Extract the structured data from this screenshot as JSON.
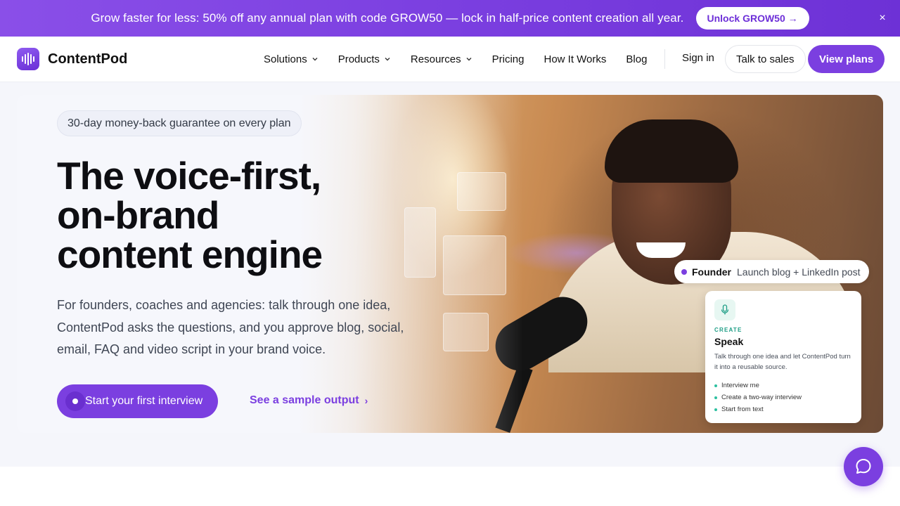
{
  "promo": {
    "text": "Grow faster for less: 50% off any annual plan with code GROW50 — lock in half-price content creation all year.",
    "button": "Unlock GROW50 →",
    "close": "×"
  },
  "nav": {
    "brand": "ContentPod",
    "links": [
      "Solutions",
      "Products",
      "Resources",
      "Pricing",
      "How It Works",
      "Blog"
    ],
    "sign_in": "Sign in",
    "talk_to_sales": "Talk to sales",
    "view_plans": "View plans"
  },
  "hero": {
    "badge": "30-day money-back guarantee on every plan",
    "headline": [
      "The voice-first,",
      "on-brand",
      "content engine"
    ],
    "subcopy": "For founders, coaches and agencies: talk through one idea, ContentPod asks the questions, and you approve blog, social, email, FAQ and video script in your brand voice.",
    "cta_primary": "Start your first interview",
    "cta_secondary": "See a sample output",
    "cta_secondary_arrow": "›"
  },
  "role_pill": {
    "role": "Founder",
    "task": "Launch blog + LinkedIn post"
  },
  "speak_card": {
    "label": "CREATE",
    "title": "Speak",
    "description": "Talk through one idea and let ContentPod turn it into a reusable source.",
    "items": [
      "Interview me",
      "Create a two-way interview",
      "Start from text"
    ]
  },
  "colors": {
    "accent": "#7b3fe0",
    "promo_gradient_start": "#8a4fe8",
    "teal": "#1f9e86"
  },
  "icons": {
    "logo": "waveform-icon",
    "close": "close-icon",
    "chevron": "chevron-down-icon",
    "mic": "microphone-icon",
    "chat": "chat-bubble-icon"
  }
}
